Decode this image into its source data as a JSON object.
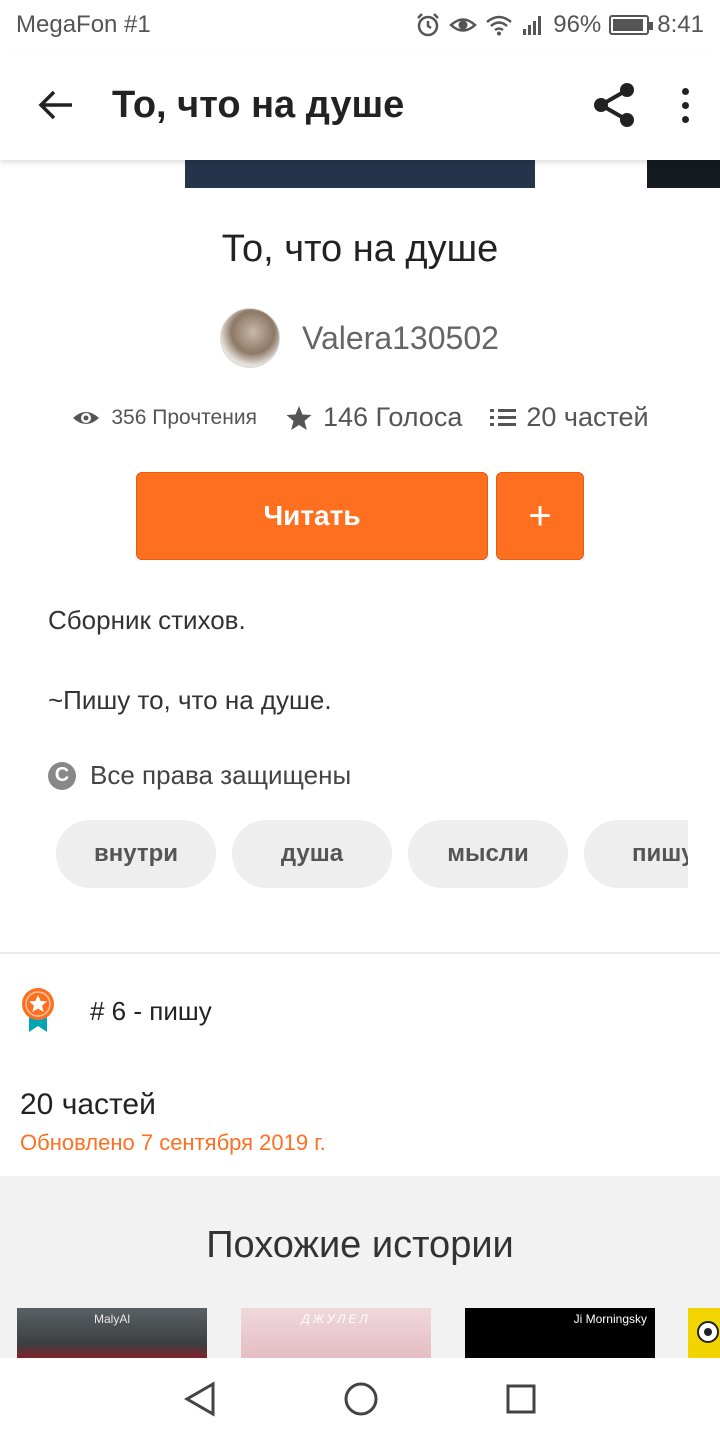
{
  "status_bar": {
    "carrier": "MegaFon #1",
    "battery": "96%",
    "battery_level": 0.96,
    "time": "8:41",
    "icons": [
      "alarm-icon",
      "eye-icon",
      "wifi-icon",
      "signal-icon",
      "battery-icon"
    ]
  },
  "app_bar": {
    "title": "То, что на душе",
    "icons": [
      "back-arrow-icon",
      "share-icon",
      "more-vert-icon"
    ]
  },
  "story": {
    "title": "То, что на душе",
    "author": "Valera130502",
    "stats": {
      "reads": "356 Прочтения",
      "votes": "146 Голоса",
      "parts": "20 частей"
    },
    "read_button": "Читать",
    "add_button": "+",
    "description": [
      "Сборник стихов.",
      "~Пишу то, что на душе."
    ],
    "copyright": "Все права защищены",
    "copyright_icon": "C",
    "tags": [
      "внутри",
      "душа",
      "мысли",
      "пишу"
    ]
  },
  "ranking": {
    "text": "# 6 - пишу",
    "icon": "award-ribbon-icon"
  },
  "parts": {
    "title": "20 частей",
    "updated": "Обновлено 7 сентября 2019 г."
  },
  "similar": {
    "title": "Похожие истории",
    "covers": [
      {
        "label": "MalyAl"
      },
      {
        "label": "ДЖУЛЕЛ"
      },
      {
        "label": "Ji Morningsky"
      },
      {
        "label": ""
      }
    ]
  },
  "nav_bar": {
    "icons": [
      "back-triangle-icon",
      "home-circle-icon",
      "recents-square-icon"
    ]
  },
  "colors": {
    "accent": "#ff6f20",
    "text": "#222222",
    "chip_bg": "#eeeeee",
    "similar_bg": "#f2f2f2"
  }
}
